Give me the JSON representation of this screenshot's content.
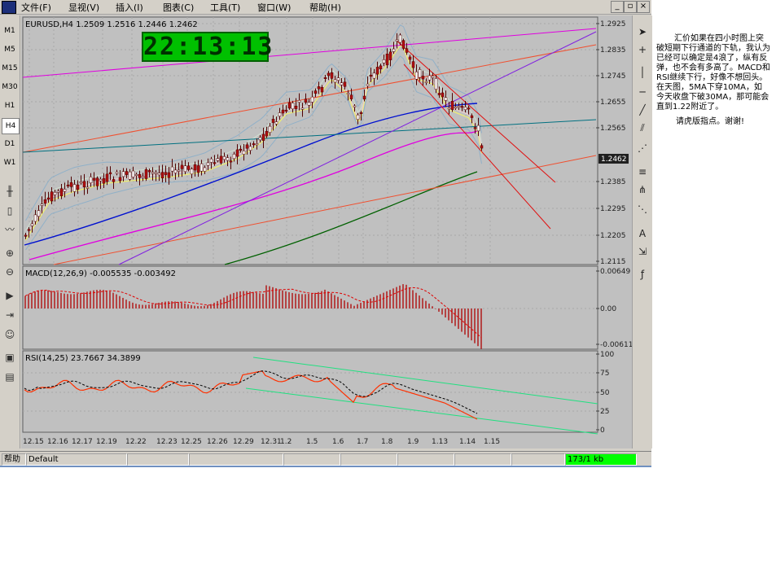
{
  "menu": {
    "items": [
      "文件(F)",
      "显视(V)",
      "插入(I)",
      "图表(C)",
      "工具(T)",
      "窗口(W)",
      "帮助(H)"
    ],
    "controls": [
      "_",
      "▫",
      "×"
    ]
  },
  "timeframes": [
    "M1",
    "M5",
    "M15",
    "M30",
    "H1",
    "H4",
    "D1",
    "W1"
  ],
  "active_timeframe": "H4",
  "clock": "22:13:13",
  "chart": {
    "symbol_label": "EURUSD,H4  1.2509 1.2516 1.2446 1.2462",
    "price_ticks": [
      "1.2925",
      "1.2835",
      "1.2745",
      "1.2655",
      "1.2565",
      "1.2462",
      "1.2385",
      "1.2295",
      "1.2205",
      "1.2115"
    ],
    "current_price": "1.2462",
    "date_labels": [
      "12.15",
      "12.16",
      "12.17",
      "12.19",
      "12.22",
      "12.23",
      "12.25",
      "12.26",
      "12.29",
      "12.31",
      "1.2",
      "1.5",
      "1.6",
      "1.7",
      "1.8",
      "1.9",
      "1.13",
      "1.14",
      "1.15"
    ]
  },
  "macd": {
    "label": "MACD(12,26,9)  -0.005535  -0.003492",
    "ticks": [
      "0.00649",
      "0.00",
      "-0.00611"
    ]
  },
  "rsi": {
    "label": "RSI(14,25)  23.7667  34.3899",
    "ticks": [
      "100",
      "75",
      "50",
      "25",
      "0"
    ]
  },
  "status": {
    "left": "帮助",
    "profile": "Default",
    "connection": "173/1 kb"
  },
  "note": {
    "paragraph": "汇价如果在四小时图上突破短期下行通道的下轨，我认为已经可以确定是4浪了，纵有反弹，也不会有多高了。MACD和RSI继续下行，好像不想回头。在天图，5MA下穿10MA，如今天收盘下破30MA，那可能会直到1.22附近了。",
    "thanks": "请虎版指点。谢谢!"
  },
  "colors": {
    "chart_bg": "#c0c0c0",
    "candle": "#b01010",
    "clock_bg": "#00c000",
    "status_green": "#00ff00"
  }
}
